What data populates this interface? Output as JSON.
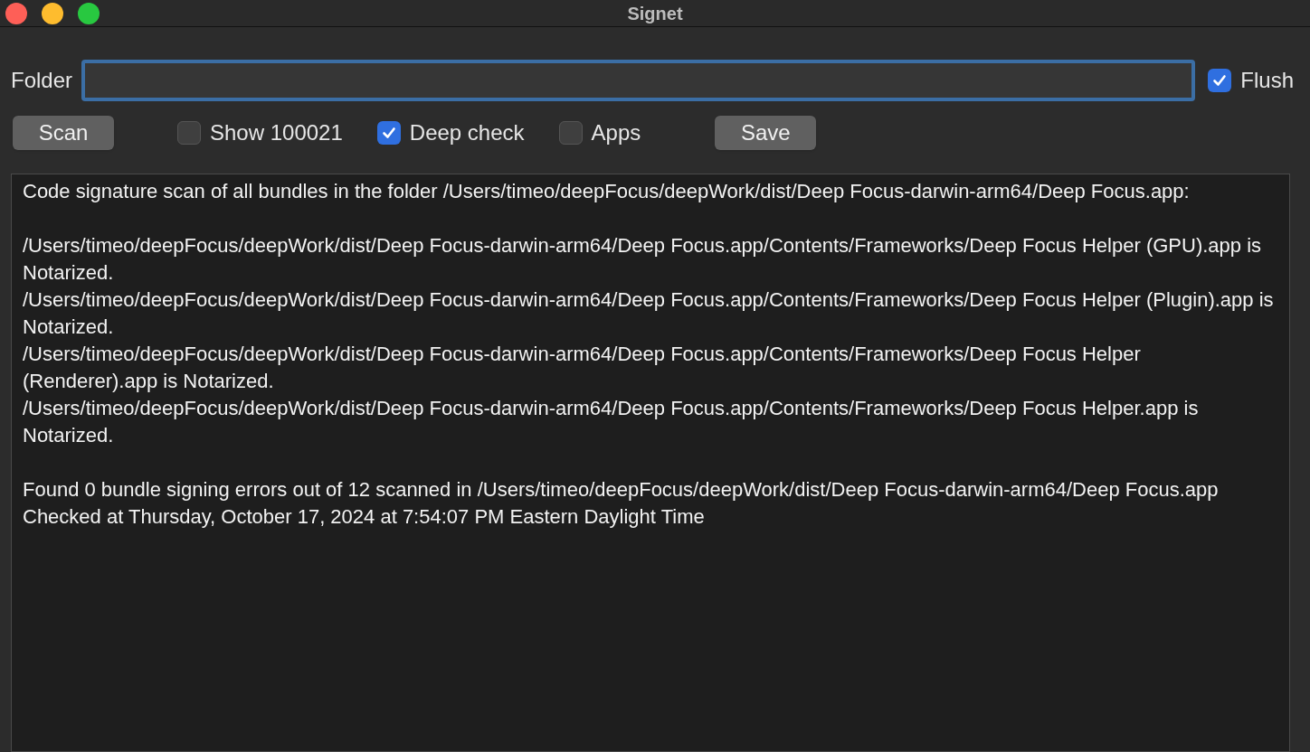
{
  "window": {
    "title": "Signet"
  },
  "folder": {
    "label": "Folder"
  },
  "options": [
    {
      "label": "Flush",
      "checked": true
    }
  ],
  "toolbar": [
    {
      "kind": "button",
      "label": "Scan"
    },
    {
      "kind": "checkbox",
      "label": "Show 100021",
      "checked": false
    },
    {
      "kind": "checkbox",
      "label": "Deep check",
      "checked": true
    },
    {
      "kind": "checkbox",
      "label": "Apps",
      "checked": false
    },
    {
      "kind": "button",
      "label": "Save"
    }
  ],
  "log": [
    [
      "Code signature scan of all bundles in the folder /Users/timeo/deepFocus/deepWork/dist/Deep Focus-darwin-arm64/Deep Focus.app:"
    ],
    [
      "/Users/timeo/deepFocus/deepWork/dist/Deep Focus-darwin-arm64/Deep Focus.app/Contents/Frameworks/Deep Focus Helper (GPU).app is Notarized.",
      "/Users/timeo/deepFocus/deepWork/dist/Deep Focus-darwin-arm64/Deep Focus.app/Contents/Frameworks/Deep Focus Helper (Plugin).app is Notarized.",
      "/Users/timeo/deepFocus/deepWork/dist/Deep Focus-darwin-arm64/Deep Focus.app/Contents/Frameworks/Deep Focus Helper (Renderer).app is Notarized.",
      "/Users/timeo/deepFocus/deepWork/dist/Deep Focus-darwin-arm64/Deep Focus.app/Contents/Frameworks/Deep Focus Helper.app is Notarized."
    ],
    [
      "Found 0 bundle signing errors out of 12 scanned in /Users/timeo/deepFocus/deepWork/dist/Deep Focus-darwin-arm64/Deep Focus.app",
      "Checked at Thursday, October 17, 2024 at 7:54:07 PM Eastern Daylight Time"
    ]
  ]
}
